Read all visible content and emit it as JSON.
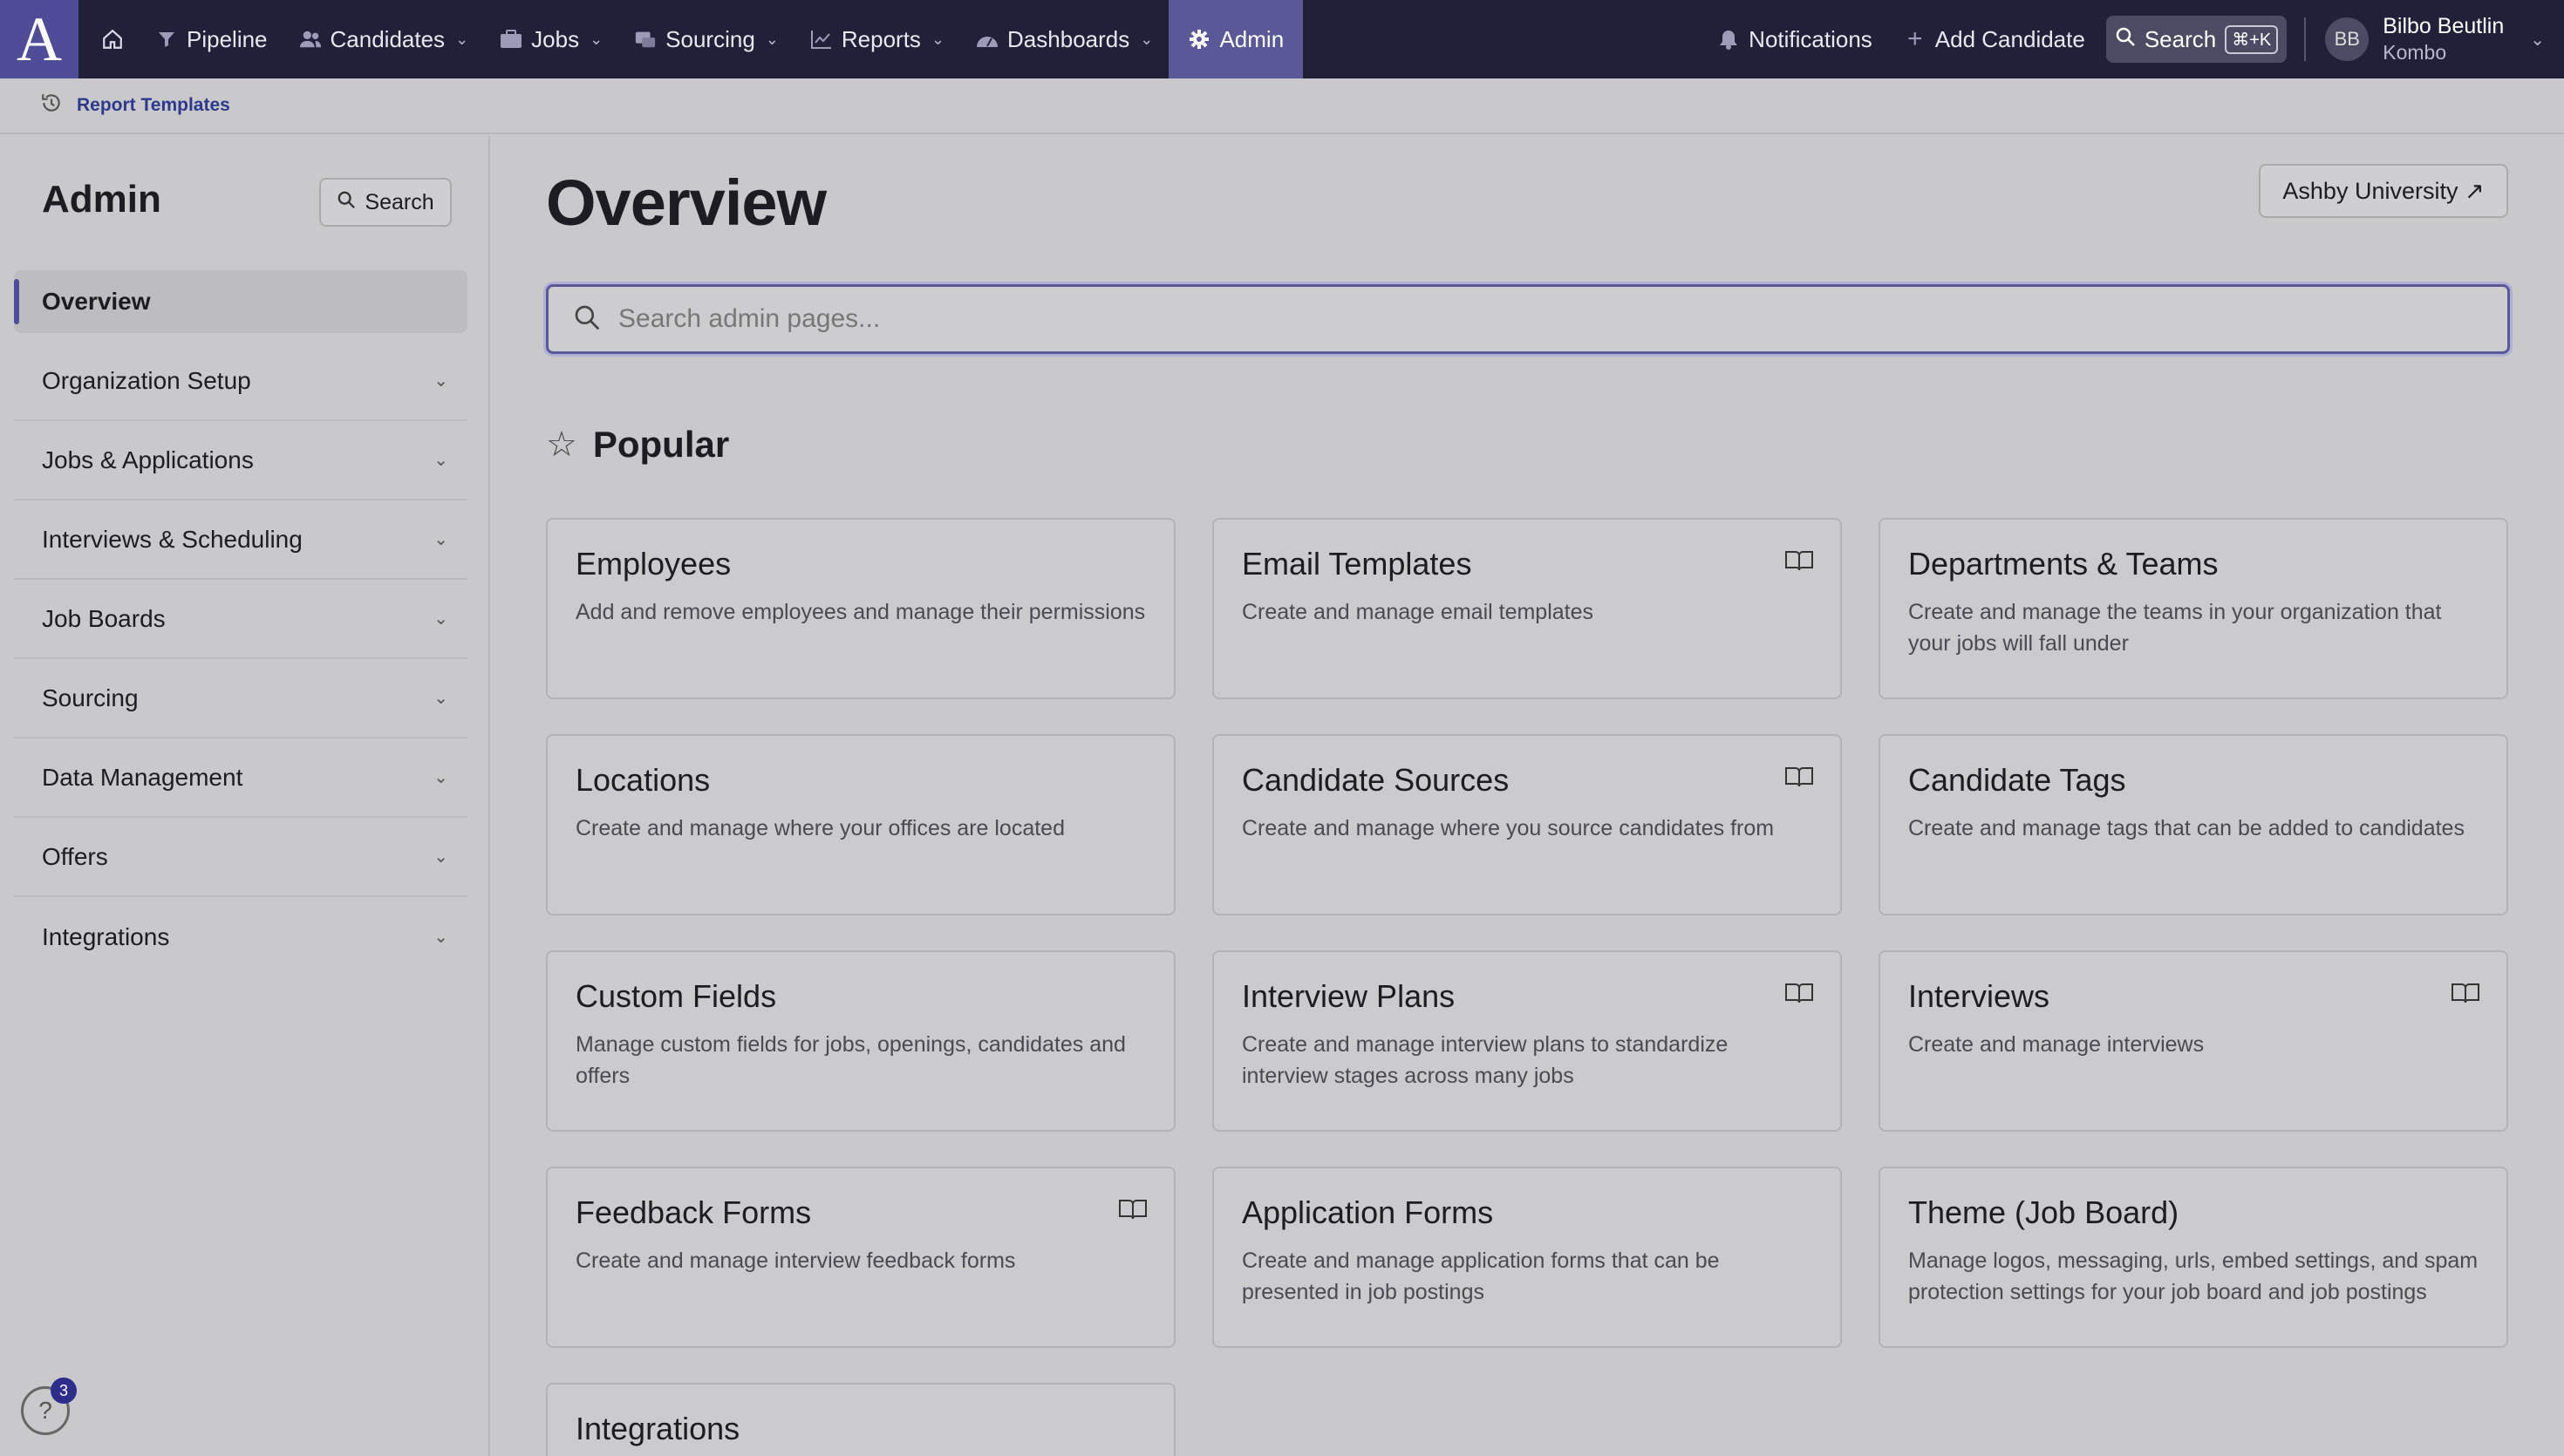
{
  "nav": {
    "logo": "A",
    "items": [
      {
        "label": "Pipeline",
        "icon": "filter-icon",
        "chevron": false
      },
      {
        "label": "Candidates",
        "icon": "users-icon",
        "chevron": true
      },
      {
        "label": "Jobs",
        "icon": "briefcase-icon",
        "chevron": true
      },
      {
        "label": "Sourcing",
        "icon": "sourcing-icon",
        "chevron": true
      },
      {
        "label": "Reports",
        "icon": "chart-icon",
        "chevron": true
      },
      {
        "label": "Dashboards",
        "icon": "gauge-icon",
        "chevron": true
      },
      {
        "label": "Admin",
        "icon": "gear-icon",
        "chevron": false
      }
    ],
    "notifications": "Notifications",
    "add_candidate": "Add Candidate",
    "search": "Search",
    "shortcut": "⌘+K",
    "user_initials": "BB",
    "user_name": "Bilbo Beutlin",
    "user_org": "Kombo"
  },
  "breadcrumb": {
    "link": "Report Templates"
  },
  "sidebar": {
    "title": "Admin",
    "search": "Search",
    "items": [
      {
        "label": "Overview"
      },
      {
        "label": "Organization Setup"
      },
      {
        "label": "Jobs & Applications"
      },
      {
        "label": "Interviews & Scheduling"
      },
      {
        "label": "Job Boards"
      },
      {
        "label": "Sourcing"
      },
      {
        "label": "Data Management"
      },
      {
        "label": "Offers"
      },
      {
        "label": "Integrations"
      }
    ],
    "help_badge": "3"
  },
  "main": {
    "title": "Overview",
    "university": "Ashby University ↗",
    "search_placeholder": "Search admin pages...",
    "popular": "Popular",
    "cards": [
      {
        "title": "Employees",
        "desc": "Add and remove employees and manage their permissions",
        "book": false
      },
      {
        "title": "Email Templates",
        "desc": "Create and manage email templates",
        "book": true
      },
      {
        "title": "Departments & Teams",
        "desc": "Create and manage the teams in your organization that your jobs will fall under",
        "book": false
      },
      {
        "title": "Locations",
        "desc": "Create and manage where your offices are located",
        "book": false
      },
      {
        "title": "Candidate Sources",
        "desc": "Create and manage where you source candidates from",
        "book": true
      },
      {
        "title": "Candidate Tags",
        "desc": "Create and manage tags that can be added to candidates",
        "book": false
      },
      {
        "title": "Custom Fields",
        "desc": "Manage custom fields for jobs, openings, candidates and offers",
        "book": false
      },
      {
        "title": "Interview Plans",
        "desc": "Create and manage interview plans to standardize interview stages across many jobs",
        "book": true
      },
      {
        "title": "Interviews",
        "desc": "Create and manage interviews",
        "book": true
      },
      {
        "title": "Feedback Forms",
        "desc": "Create and manage interview feedback forms",
        "book": true
      },
      {
        "title": "Application Forms",
        "desc": "Create and manage application forms that can be presented in job postings",
        "book": false
      },
      {
        "title": "Theme (Job Board)",
        "desc": "Manage logos, messaging, urls, embed settings, and spam protection settings for your job board and job postings",
        "book": false
      },
      {
        "title": "Integrations",
        "desc": "",
        "book": false
      }
    ]
  }
}
